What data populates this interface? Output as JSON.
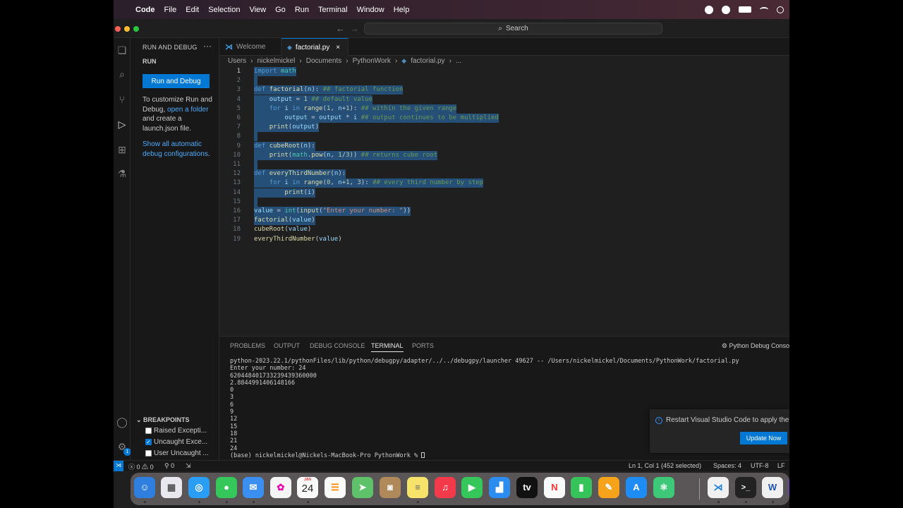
{
  "menubar": {
    "app": "Code",
    "items": [
      "File",
      "Edit",
      "Selection",
      "View",
      "Go",
      "Run",
      "Terminal",
      "Window",
      "Help"
    ]
  },
  "titlebar": {
    "search_label": "Search"
  },
  "sidebar": {
    "title": "RUN AND DEBUG",
    "section": "RUN",
    "run_button": "Run and Debug",
    "customize_1": "To customize Run and Debug,",
    "customize_link": "open a folder",
    "customize_2": "and create a launch.json file.",
    "show_link": "Show all automatic debug configurations",
    "show_end": ".",
    "breakpoints_header": "BREAKPOINTS",
    "breakpoints": [
      {
        "label": "Raised Excepti...",
        "checked": false
      },
      {
        "label": "Uncaught Exce...",
        "checked": true
      },
      {
        "label": "User Uncaught ...",
        "checked": false
      }
    ],
    "settings_badge": "1"
  },
  "tabs": [
    {
      "label": "Welcome",
      "active": false
    },
    {
      "label": "factorial.py",
      "active": true,
      "close": "×"
    }
  ],
  "breadcrumbs": [
    "Users",
    "nickelmickel",
    "Documents",
    "PythonWork",
    "factorial.py",
    "..."
  ],
  "editor": {
    "line_numbers": [
      "1",
      "2",
      "3",
      "4",
      "5",
      "6",
      "7",
      "8",
      "9",
      "10",
      "11",
      "12",
      "13",
      "14",
      "15",
      "16",
      "17",
      "18",
      "19"
    ]
  },
  "panel": {
    "tabs": [
      "PROBLEMS",
      "OUTPUT",
      "DEBUG CONSOLE",
      "TERMINAL",
      "PORTS"
    ],
    "active_tab": "TERMINAL",
    "debug_label": "Python Debug Conso",
    "terminal_lines": [
      "python-2023.22.1/pythonFiles/lib/python/debugpy/adapter/../../debugpy/launcher 49627 -- /Users/nickelmickel/Documents/PythonWork/factorial.py",
      "Enter your number: 24",
      "620448401733239439360000",
      "2.8844991406148166",
      "0",
      "3",
      "6",
      "9",
      "12",
      "15",
      "18",
      "21",
      "24"
    ],
    "prompt": "(base) nickelmickel@Nickels-MacBook-Pro PythonWork % "
  },
  "notification": {
    "message": "Restart Visual Studio Code to apply the",
    "button": "Update Now"
  },
  "statusbar": {
    "errors": "0",
    "warnings": "0",
    "ports": "0",
    "position": "Ln 1, Col 1 (452 selected)",
    "spaces": "Spaces: 4",
    "encoding": "UTF-8",
    "eol": "LF"
  },
  "dock": {
    "calendar_month": "JAN",
    "calendar_day": "24",
    "apps": [
      "finder-icon",
      "launchpad-icon",
      "safari-icon",
      "messages-icon",
      "mail-icon",
      "photos-icon",
      "calendar-icon",
      "reminders-icon",
      "maps-icon",
      "contacts-icon",
      "notes-icon",
      "music-icon",
      "facetime-icon",
      "keynote-icon",
      "appletv-icon",
      "news-icon",
      "numbers-icon",
      "pages-icon",
      "appstore-icon",
      "atom-icon",
      "vscode-icon",
      "terminal-icon",
      "word-icon",
      "github-icon"
    ]
  },
  "colors": {
    "accent": "#0078d4",
    "selection": "#264f78",
    "editor_bg": "#1f1f1f"
  }
}
